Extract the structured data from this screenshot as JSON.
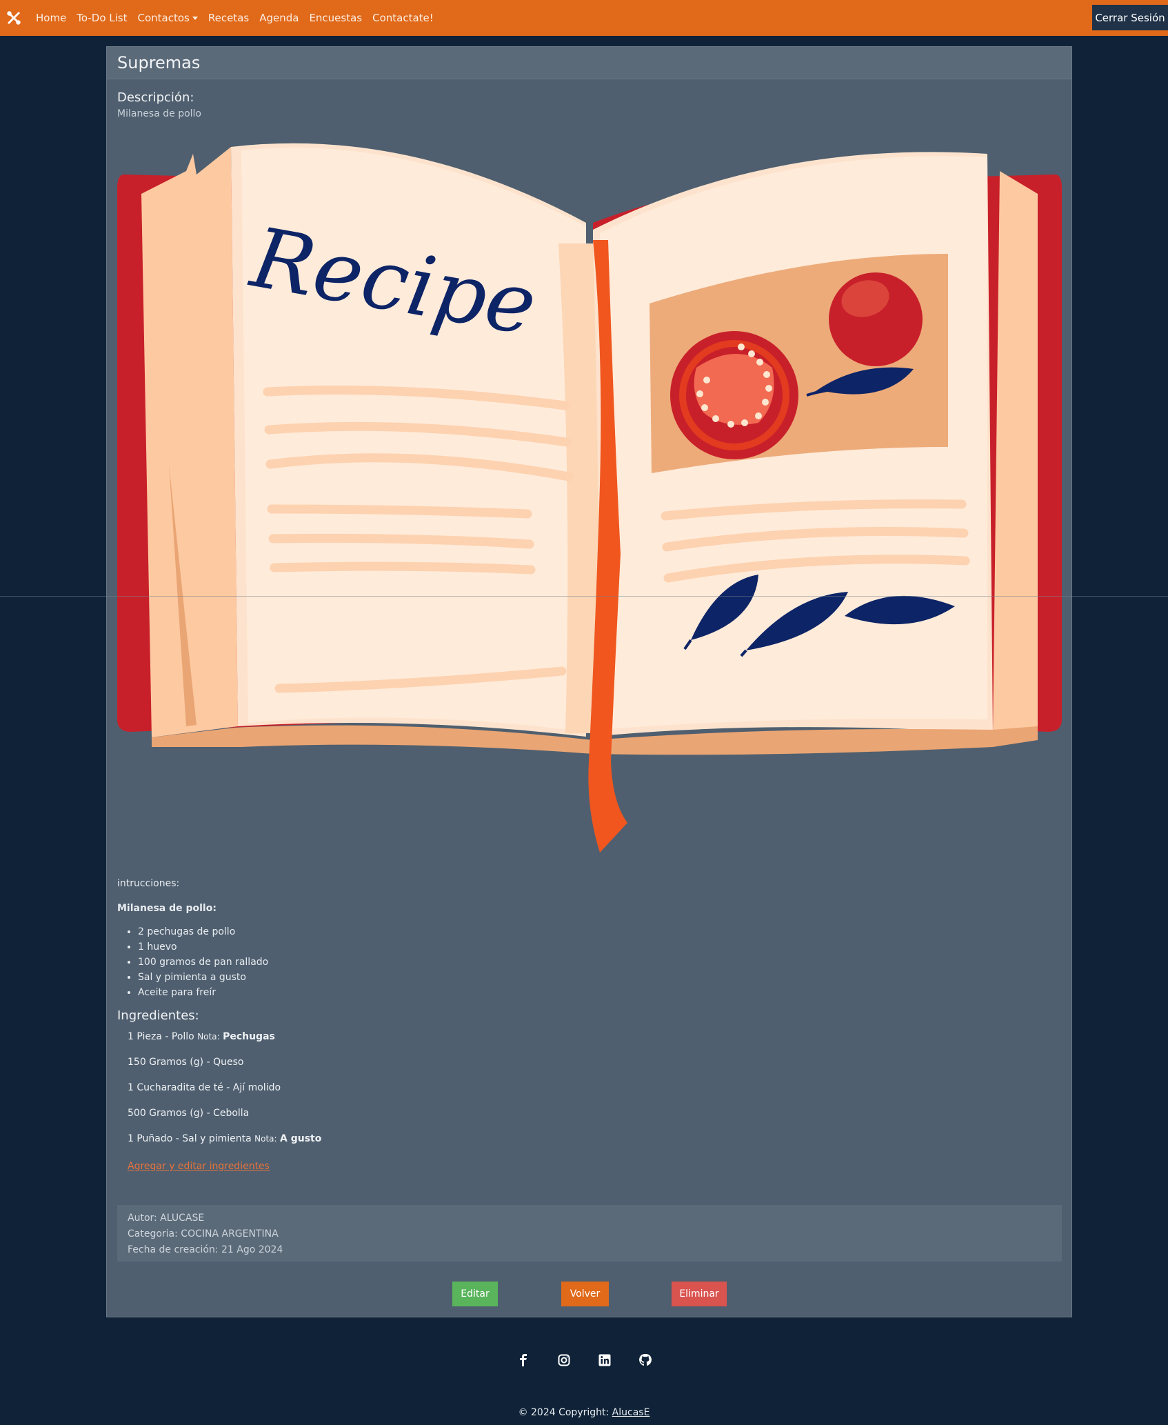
{
  "nav": {
    "links": [
      "Home",
      "To-Do List",
      "Contactos",
      "Recetas",
      "Agenda",
      "Encuestas",
      "Contactate!"
    ],
    "logout": "Cerrar Sesión"
  },
  "recipe": {
    "title": "Supremas",
    "desc_label": "Descripción:",
    "desc": "Milanesa de pollo",
    "image_text": "Recipe",
    "instr_label": "intrucciones:",
    "subtitle": "Milanesa de pollo:",
    "steps": [
      "2 pechugas de pollo",
      "1 huevo",
      "100 gramos de pan rallado",
      "Sal y pimienta a gusto",
      "Aceite para freír"
    ],
    "ingredients_title": "Ingredientes:",
    "ingredients": [
      {
        "text": "1 Pieza - Pollo",
        "note_label": "Nota:",
        "note": "Pechugas"
      },
      {
        "text": "150 Gramos (g) - Queso",
        "note_label": "",
        "note": ""
      },
      {
        "text": "1 Cucharadita de té - Ají molido",
        "note_label": "",
        "note": ""
      },
      {
        "text": "500 Gramos (g) - Cebolla",
        "note_label": "",
        "note": ""
      },
      {
        "text": "1 Puñado - Sal y pimienta",
        "note_label": "Nota:",
        "note": "A gusto"
      }
    ],
    "add_link": "Agregar y editar ingredientes",
    "author": "Autor: ALUCASE",
    "category": "Categoria: COCINA ARGENTINA",
    "date": "Fecha de creación: 21 Ago 2024",
    "buttons": {
      "edit": "Editar",
      "back": "Volver",
      "delete": "Eliminar"
    }
  },
  "footer": {
    "icons": [
      "facebook-icon",
      "instagram-icon",
      "linkedin-icon",
      "github-icon"
    ],
    "copyright": "© 2024 Copyright: ",
    "copyright_link": "AlucasE"
  },
  "colors": {
    "navbar": "#e0691a",
    "background": "#0f2237",
    "card": "#4f5f6f",
    "edit": "#59b45c",
    "delete": "#d9534f"
  }
}
